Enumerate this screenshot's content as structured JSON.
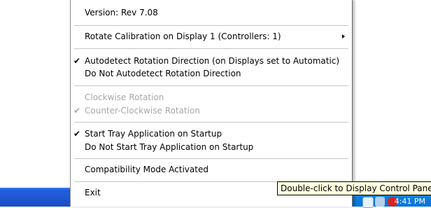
{
  "menu": {
    "version": "Version:  Rev 7.08",
    "rotate_calibration": "Rotate Calibration on Display 1 (Controllers: 1)",
    "autodetect": "Autodetect Rotation Direction (on Displays set to Automatic)",
    "no_autodetect": "Do Not Autodetect Rotation Direction",
    "clockwise": "Clockwise Rotation",
    "counter_clockwise": "Counter-Clockwise Rotation",
    "start_tray": "Start Tray Application on Startup",
    "no_start_tray": "Do Not Start Tray Application on Startup",
    "compat_mode": "Compatibility Mode Activated",
    "exit": "Exit",
    "check_glyph": "✔",
    "autodetect_checked": true,
    "counter_clockwise_checked": true,
    "start_tray_checked": true
  },
  "tooltip": {
    "text": "Double-click to Display Control Panel"
  },
  "taskbar": {
    "clock": "4:41 PM",
    "tray_icons": [
      "arrow-icon",
      "pen-icon",
      "shield-alert-icon"
    ]
  },
  "colors": {
    "taskbar": "#245edb",
    "tray": "#0f7fe0",
    "tooltip_bg": "#ffffe1",
    "disabled_text": "#a7a7a7"
  }
}
